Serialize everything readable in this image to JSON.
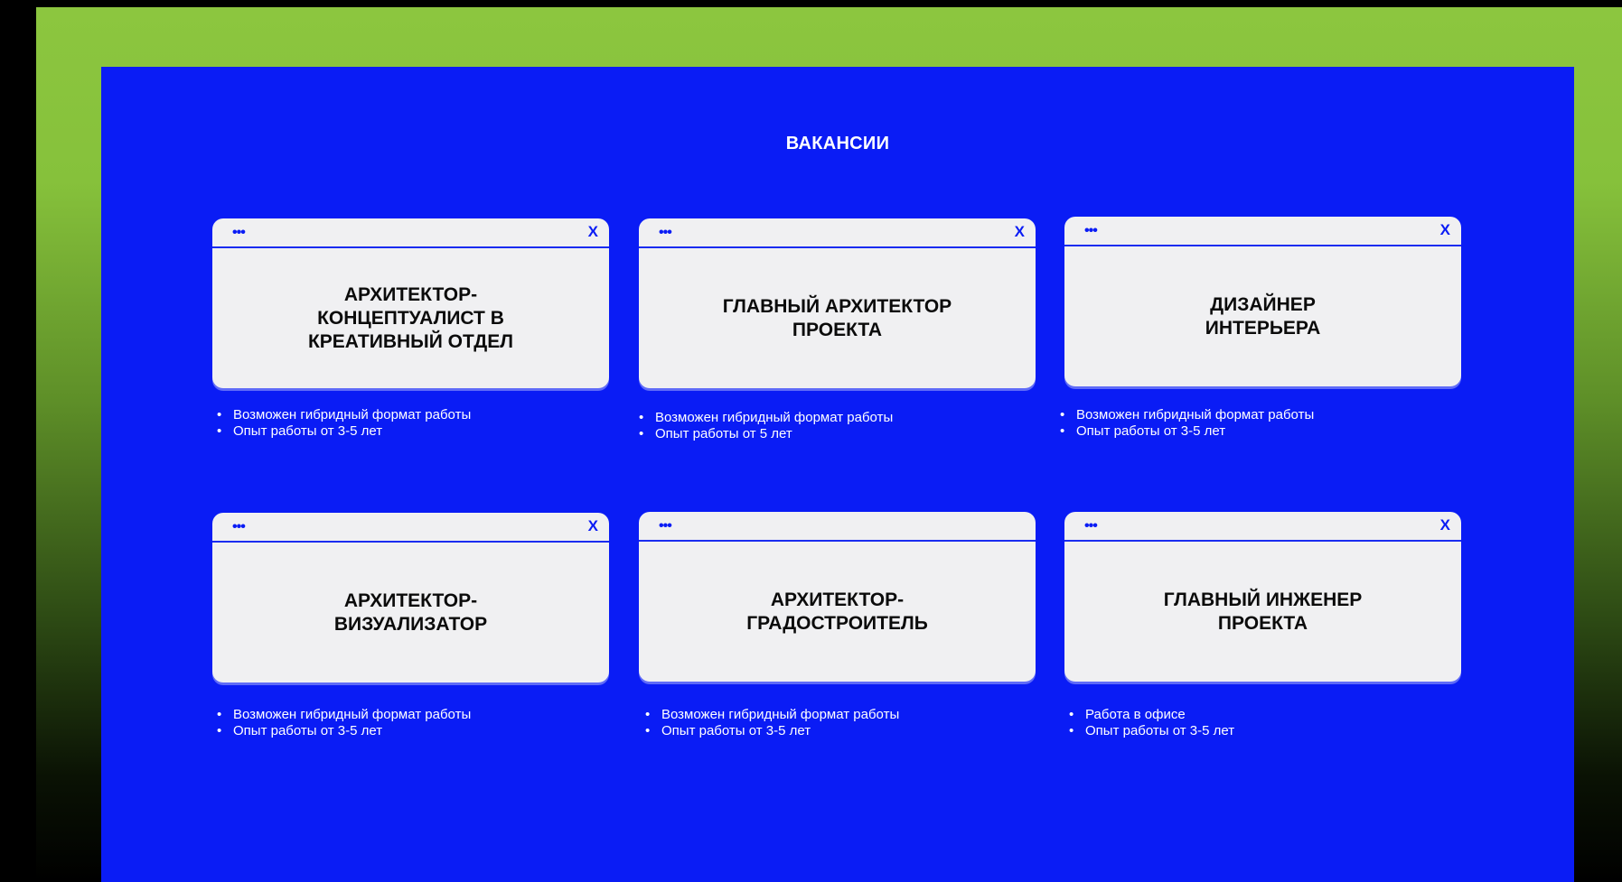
{
  "header": {
    "title": "ВАКАНСИИ"
  },
  "card_icons": {
    "dots": "•••",
    "close": "X"
  },
  "colors": {
    "panel": "#0a1cf5",
    "card": "#f0f0f2",
    "accent": "#0a1cf5",
    "frame_top": "#8cc63f"
  },
  "vacancies": [
    {
      "title": "АРХИТЕКТОР-\nКОНЦЕПТУАЛИСТ В\nКРЕАТИВНЫЙ ОТДЕЛ",
      "requirements": [
        "Возможен гибридный формат работы",
        "Опыт работы от 3-5 лет"
      ],
      "has_close": true
    },
    {
      "title": "ГЛАВНЫЙ АРХИТЕКТОР\nПРОЕКТА",
      "requirements": [
        "Возможен гибридный формат работы",
        "Опыт работы от 5 лет"
      ],
      "has_close": true
    },
    {
      "title": "ДИЗАЙНЕР\nИНТЕРЬЕРА",
      "requirements": [
        "Возможен гибридный формат работы",
        "Опыт работы от 3-5 лет"
      ],
      "has_close": true
    },
    {
      "title": "АРХИТЕКТОР-\nВИЗУАЛИЗАТОР",
      "requirements": [
        "Возможен гибридный формат работы",
        "Опыт работы от 3-5 лет"
      ],
      "has_close": true
    },
    {
      "title": "АРХИТЕКТОР-\nГРАДОСТРОИТЕЛЬ",
      "requirements": [
        "Возможен гибридный формат работы",
        "Опыт работы от 3-5 лет"
      ],
      "has_close": false
    },
    {
      "title": "ГЛАВНЫЙ ИНЖЕНЕР\nПРОЕКТА",
      "requirements": [
        "Работа в офисе",
        "Опыт работы от 3-5 лет"
      ],
      "has_close": true
    }
  ]
}
